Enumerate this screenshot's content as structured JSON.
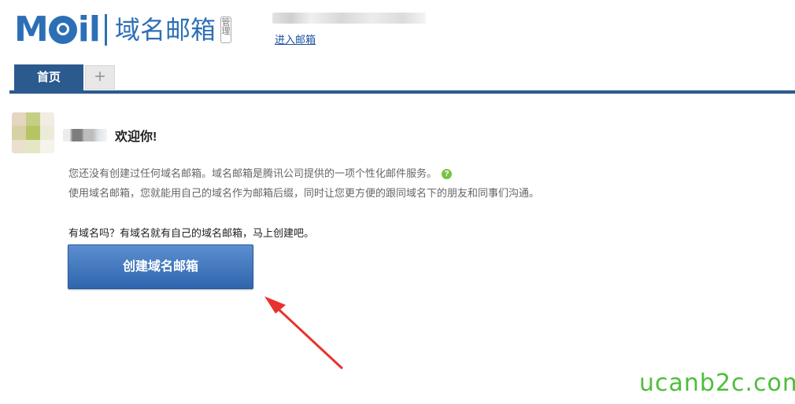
{
  "header": {
    "logo_text": "MOil",
    "title": "域名邮箱",
    "badge": "管理",
    "enter_link": "进入邮箱",
    "brand_color": "#2d6fb7"
  },
  "tabs": {
    "home": "首页",
    "add": "+"
  },
  "welcome": {
    "greeting": "欢迎你!",
    "avatar_colors": [
      "#e6d6c0",
      "#c4cf86",
      "#f2ece2",
      "#d7d2a6",
      "#b7c464",
      "#ecebd7",
      "#e9e0cd",
      "#e4e7c4",
      "#f6f3ea"
    ]
  },
  "description": {
    "line1": "您还没有创建过任何域名邮箱。域名邮箱是腾讯公司提供的一项个性化邮件服务。",
    "line2": "使用域名邮箱，您就能用自己的域名作为邮箱后缀，同时让您更方便的跟同域名下的朋友和同事们沟通。",
    "help_icon": "question-mark"
  },
  "prompt": "有域名吗？有域名就有自己的域名邮箱，马上创建吧。",
  "create_button": "创建域名邮箱",
  "watermark": "ucanb2c.com"
}
